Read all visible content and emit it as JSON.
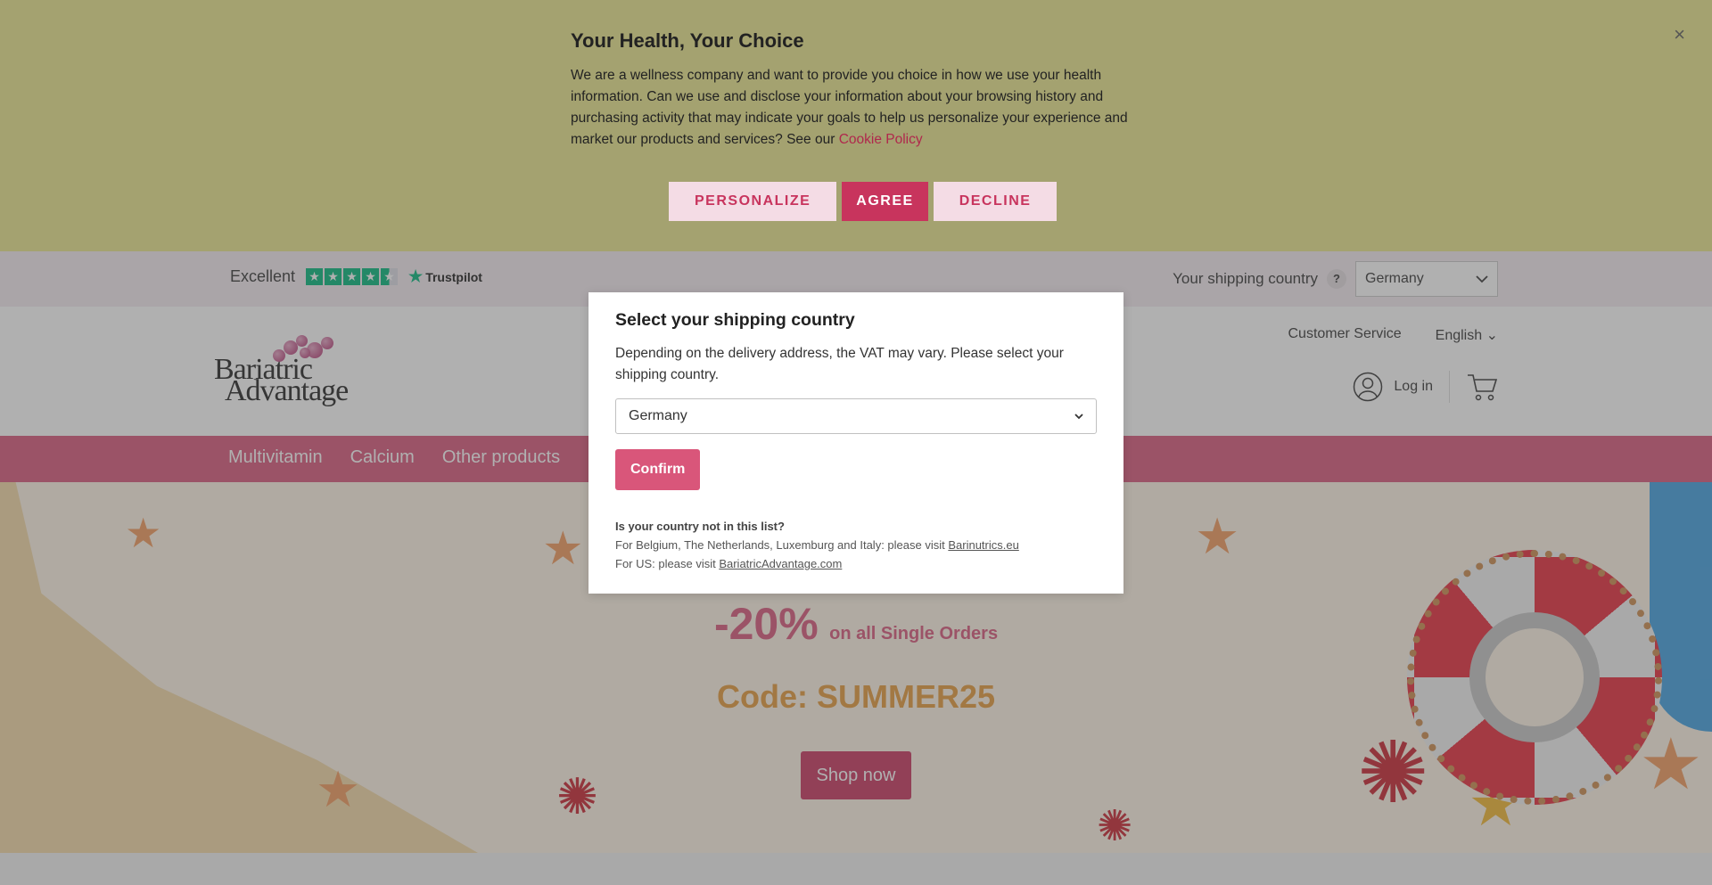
{
  "cookie_banner": {
    "title": "Your Health, Your Choice",
    "text": "We are a wellness company and want to provide you choice in how we use your health information. Can we use and disclose your information about your browsing history and purchasing activity that may indicate your goals to help us personalize your experience and market our products and services? See our ",
    "link": "Cookie Policy",
    "buttons": {
      "personalize": "PERSONALIZE",
      "agree": "AGREE",
      "decline": "DECLINE"
    },
    "close_icon": "×"
  },
  "topbar": {
    "rating": "Excellent",
    "trustpilot": "Trustpilot",
    "shipping_label": "Your shipping country",
    "help": "?",
    "country": "Germany"
  },
  "header": {
    "logo_line1": "Bariatric",
    "logo_line2": "Advantage",
    "customer_service": "Customer Service",
    "language": "English",
    "login": "Log in"
  },
  "nav": {
    "items": [
      "Multivitamin",
      "Calcium",
      "Other products"
    ]
  },
  "hero": {
    "discount": "-20%",
    "discount_sub": "on all Single Orders",
    "code": "Code: SUMMER25",
    "button": "Shop now"
  },
  "modal": {
    "title": "Select your shipping country",
    "text": "Depending on the delivery address, the VAT may vary. Please select your shipping country.",
    "selected_country": "Germany",
    "confirm": "Confirm",
    "not_listed": "Is your country not in this list?",
    "eu_text": "For Belgium, The Netherlands, Luxemburg and Italy: please visit ",
    "eu_link": "Barinutrics.eu",
    "us_text": "For US: please visit ",
    "us_link": "BariatricAdvantage.com"
  },
  "colors": {
    "brand_pink": "#d9567a",
    "cookie_bg": "#e9e58a",
    "trustpilot_green": "#00b67a",
    "code_orange": "#e69a3a"
  }
}
